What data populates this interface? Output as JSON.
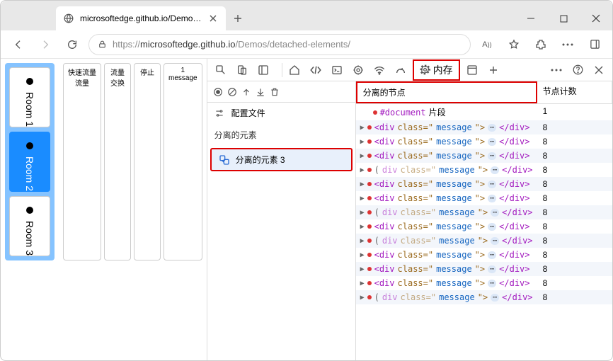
{
  "browser": {
    "tab_title": "microsoftedge.github.io/Demos/c",
    "url_prefix": "https://",
    "url_host": "microsoftedge.github.io",
    "url_path": "/Demos/detached-elements/"
  },
  "rooms": [
    {
      "label": "Room 1",
      "active": false
    },
    {
      "label": "Room 2",
      "active": true
    },
    {
      "label": "Room 3",
      "active": false
    }
  ],
  "page_toolbar": [
    {
      "line1": "快速流量",
      "line2": "流量"
    },
    {
      "line1": "流量",
      "line2": "交换"
    },
    {
      "line1": "停止",
      "line2": ""
    },
    {
      "line1": "1",
      "line2": "message"
    }
  ],
  "devtools": {
    "memory_tab": "内存",
    "config_label": "配置文件",
    "detached_header": "分离的元素",
    "entry_label": "分离的元素 3",
    "columns": {
      "col1": "分离的节点",
      "col2": "节点计数"
    },
    "rows": [
      {
        "kind": "doc",
        "text": "#document 片段",
        "count": "1"
      },
      {
        "kind": "el",
        "faded": false,
        "count": "8"
      },
      {
        "kind": "el",
        "faded": false,
        "count": "8"
      },
      {
        "kind": "el",
        "faded": false,
        "count": "8"
      },
      {
        "kind": "el",
        "faded": true,
        "count": "8"
      },
      {
        "kind": "el",
        "faded": false,
        "count": "8"
      },
      {
        "kind": "el",
        "faded": false,
        "count": "8"
      },
      {
        "kind": "el",
        "faded": true,
        "count": "8"
      },
      {
        "kind": "el",
        "faded": false,
        "count": "8"
      },
      {
        "kind": "el",
        "faded": true,
        "count": "8"
      },
      {
        "kind": "el",
        "faded": false,
        "count": "8"
      },
      {
        "kind": "el",
        "faded": false,
        "count": "8"
      },
      {
        "kind": "el",
        "faded": false,
        "count": "8"
      },
      {
        "kind": "el",
        "faded": true,
        "count": "8"
      }
    ],
    "el_parts": {
      "open": "<div",
      "attr": "class=\"",
      "val": "message",
      "after_val": "\">",
      "ellipsis": "⋯",
      "close": "</div>",
      "paren_open": "(",
      "paren_tag": "div"
    }
  }
}
